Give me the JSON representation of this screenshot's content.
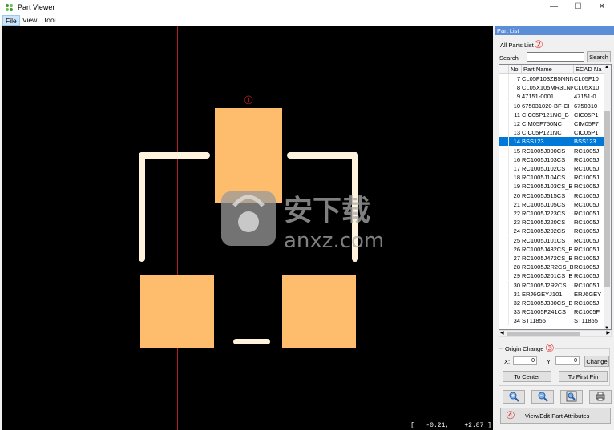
{
  "window": {
    "title": "Part Viewer",
    "minimize": "—",
    "maximize": "☐",
    "close": "✕"
  },
  "menu": [
    "File",
    "View",
    "Tool"
  ],
  "canvas": {
    "marker_1": "①",
    "coordinates": "[   -0.21,    +2.87 ]",
    "watermark_cn": "安下载",
    "watermark_url": "anxz.com"
  },
  "panel": {
    "header": "Part List",
    "all_parts_label": "All Parts List",
    "marker_2": "②",
    "search_label": "Search",
    "search_value": "",
    "search_button": "Search",
    "columns": [
      "No",
      "Part Name",
      "ECAD Na"
    ],
    "rows": [
      {
        "no": "7",
        "part": "CL05F103ZB5NNN",
        "ecad": "CL05F10"
      },
      {
        "no": "8",
        "part": "CL05X105MR3LNN",
        "ecad": "CL05X10"
      },
      {
        "no": "9",
        "part": "47151-0001",
        "ecad": "47151-0"
      },
      {
        "no": "10",
        "part": "675031020-BF-CI",
        "ecad": "6750310"
      },
      {
        "no": "11",
        "part": "CIC05P121NC_B",
        "ecad": "CIC05P1"
      },
      {
        "no": "12",
        "part": "CIM05F750NC",
        "ecad": "CIM05F7"
      },
      {
        "no": "13",
        "part": "CIC05P121NC",
        "ecad": "CIC05P1"
      },
      {
        "no": "14",
        "part": "BSS123",
        "ecad": "BSS123",
        "selected": true
      },
      {
        "no": "15",
        "part": "RC1005J000CS",
        "ecad": "RC1005J"
      },
      {
        "no": "16",
        "part": "RC1005J103CS",
        "ecad": "RC1005J"
      },
      {
        "no": "17",
        "part": "RC1005J102CS",
        "ecad": "RC1005J"
      },
      {
        "no": "18",
        "part": "RC1005J104CS",
        "ecad": "RC1005J"
      },
      {
        "no": "19",
        "part": "RC1005J103CS_B",
        "ecad": "RC1005J"
      },
      {
        "no": "20",
        "part": "RC1005J515CS",
        "ecad": "RC1005J"
      },
      {
        "no": "21",
        "part": "RC1005J105CS",
        "ecad": "RC1005J"
      },
      {
        "no": "22",
        "part": "RC1005J223CS",
        "ecad": "RC1005J"
      },
      {
        "no": "23",
        "part": "RC1005J220CS",
        "ecad": "RC1005J"
      },
      {
        "no": "24",
        "part": "RC1005J202CS",
        "ecad": "RC1005J"
      },
      {
        "no": "25",
        "part": "RC1005J101CS",
        "ecad": "RC1005J"
      },
      {
        "no": "26",
        "part": "RC1005J432CS_B",
        "ecad": "RC1005J"
      },
      {
        "no": "27",
        "part": "RC1005J472CS_B",
        "ecad": "RC1005J"
      },
      {
        "no": "28",
        "part": "RC1005J2R2CS_B",
        "ecad": "RC1005J"
      },
      {
        "no": "29",
        "part": "RC1005J201CS_B",
        "ecad": "RC1005J"
      },
      {
        "no": "30",
        "part": "RC1005J2R2CS",
        "ecad": "RC1005J"
      },
      {
        "no": "31",
        "part": "ERJ6GEYJ101",
        "ecad": "ERJ6GEY"
      },
      {
        "no": "32",
        "part": "RC1005J330CS_B",
        "ecad": "RC1005J"
      },
      {
        "no": "33",
        "part": "RC1005F241CS",
        "ecad": "RC1005F"
      },
      {
        "no": "34",
        "part": "ST11855",
        "ecad": "ST11855"
      }
    ],
    "origin_change": "Origin Change",
    "marker_3": "③",
    "x_label": "X:",
    "x_value": "0",
    "y_label": "Y:",
    "y_value": "0",
    "change_button": "Change",
    "to_center_button": "To Center",
    "to_first_pin_button": "To First Pin",
    "marker_4": "④",
    "view_edit_button": "View/Edit Part Attributes"
  },
  "colors": {
    "pad": "#fdbd6c",
    "silkscreen": "#fff3dd",
    "crosshair": "#b02020",
    "selection": "#0078d7",
    "panel_header": "#5b8ed6"
  }
}
